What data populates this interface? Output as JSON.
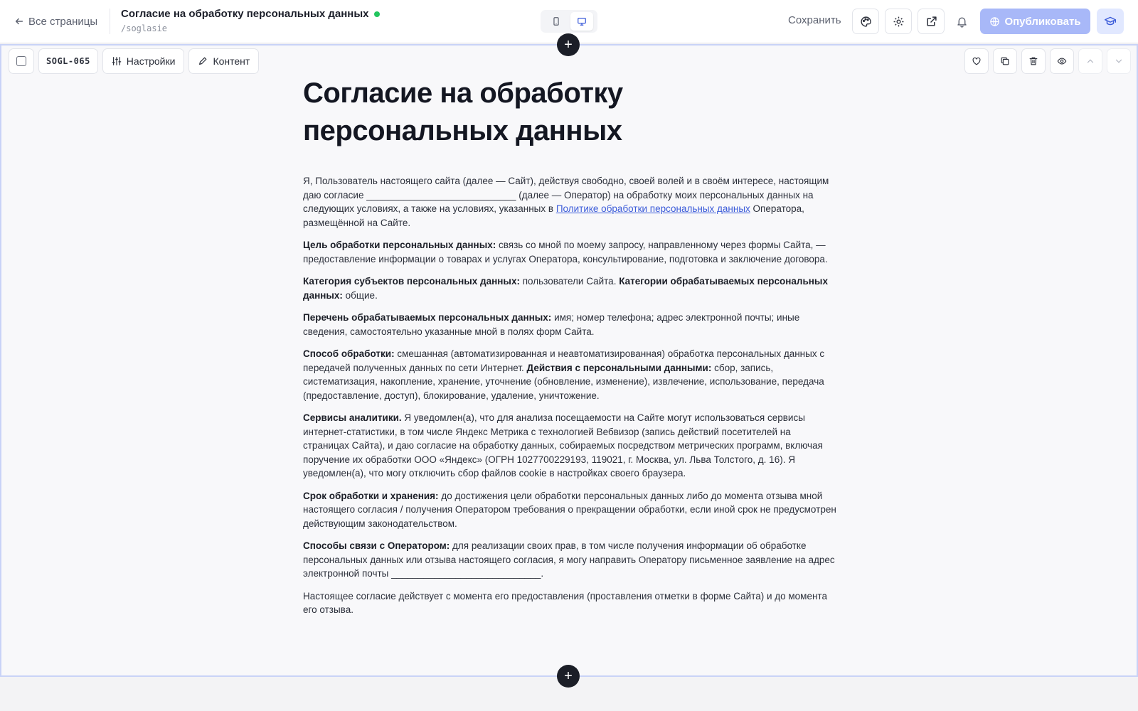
{
  "header": {
    "back_label": "Все страницы",
    "page_title": "Согласие на обработку персональных данных",
    "page_slug": "/soglasie",
    "save_label": "Сохранить",
    "publish_label": "Опубликовать"
  },
  "block": {
    "code": "SOGL-065",
    "settings_label": "Настройки",
    "content_label": "Контент"
  },
  "doc": {
    "title": "Согласие на обработку персональных данных",
    "p1_a": "Я, Пользователь настоящего сайта (далее — Сайт), действуя свободно, своей волей и в своём интересе, настоящим даю согласие ____________________________ (далее — Оператор) на обработку моих персональных данных на следующих условиях, а также на условиях, указанных в ",
    "p1_link": "Политике обработки персональных данных",
    "p1_b": " Оператора, размещённой на Сайте.",
    "p2_label": "Цель обработки персональных данных:",
    "p2_text": " связь со мной по моему запросу, направленному через формы Сайта, — предоставление информации о товарах и услугах Оператора, консультирование, подготовка и заключение договора.",
    "p3_label1": "Категория субъектов персональных данных:",
    "p3_text1": " пользователи Сайта. ",
    "p3_label2": "Категории обрабатываемых персональных данных:",
    "p3_text2": " общие.",
    "p4_label": "Перечень обрабатываемых персональных данных:",
    "p4_text": " имя; номер телефона; адрес электронной почты; иные сведения, самостоятельно указанные мной в полях форм Сайта.",
    "p5_label1": "Способ обработки:",
    "p5_text1": " смешанная (автоматизированная и неавтоматизированная) обработка персональных данных с передачей полученных данных по сети Интернет. ",
    "p5_label2": "Действия с персональными данными:",
    "p5_text2": " сбор, запись, систематизация, накопление, хранение, уточнение (обновление, изменение), извлечение, использование, передача (предоставление, доступ), блокирование, удаление, уничтожение.",
    "p6_label": "Сервисы аналитики.",
    "p6_text": " Я уведомлен(а), что для анализа посещаемости на Сайте могут использоваться сервисы интернет-статистики, в том числе Яндекс Метрика с технологией Вебвизор (запись действий посетителей на страницах Сайта), и даю согласие на обработку данных, собираемых посредством метрических программ, включая поручение их обработки ООО «Яндекс» (ОГРН 1027700229193, 119021, г. Москва, ул. Льва Толстого, д. 16). Я уведомлен(а), что могу отключить сбор файлов cookie в настройках своего браузера.",
    "p7_label": "Срок обработки и хранения:",
    "p7_text": " до достижения цели обработки персональных данных либо до момента отзыва мной настоящего согласия / получения Оператором требования о прекращении обработки, если иной срок не предусмотрен действующим законодательством.",
    "p8_label": "Способы связи с Оператором:",
    "p8_text": " для реализации своих прав, в том числе получения информации об обработке персональных данных или отзыва настоящего согласия, я могу направить Оператору письменное заявление на адрес электронной почты ____________________________.",
    "p9_text": "Настоящее согласие действует с момента его предоставления (проставления отметки в форме Сайта) и до момента его отзыва."
  },
  "icons": {
    "back": "arrow-left-icon",
    "mobile": "smartphone-icon",
    "desktop": "monitor-icon",
    "theme": "palette-icon",
    "settings": "gear-icon",
    "open": "external-link-icon",
    "notifications": "bell-icon",
    "publish": "globe-icon",
    "learn": "graduation-cap-icon"
  },
  "colors": {
    "accent": "#3b5bd9",
    "publish_disabled": "#a8b8f8",
    "status_online": "#22c55e",
    "selection_border": "#c9d3f7"
  }
}
